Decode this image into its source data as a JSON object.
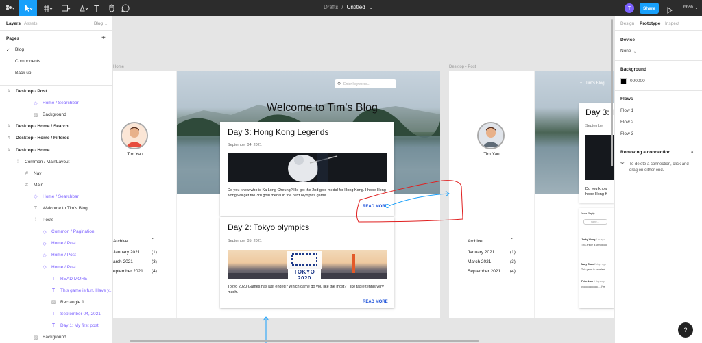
{
  "toolbar": {
    "breadcrumb_drafts": "Drafts",
    "separator": "/",
    "file_name": "Untitled",
    "avatar_letter": "T",
    "share_label": "Share",
    "zoom": "66%"
  },
  "left_panel": {
    "tab_layers": "Layers",
    "tab_assets": "Assets",
    "page_selector": "Blog",
    "pages_title": "Pages",
    "add_symbol": "+",
    "pages": [
      "Blog",
      "Components",
      "Back up"
    ],
    "layers": [
      {
        "label": "Desktop - Post",
        "kind": "frame",
        "bold": true
      },
      {
        "label": "Home / Searchbar",
        "kind": "component",
        "bold": false
      },
      {
        "label": "Background",
        "kind": "image",
        "bold": false
      },
      {
        "label": "Desktop - Home / Search",
        "kind": "frame",
        "bold": true
      },
      {
        "label": "Desktop - Home / Filtered",
        "kind": "frame",
        "bold": true
      },
      {
        "label": "Desktop - Home",
        "kind": "frame",
        "bold": true
      },
      {
        "label": "Common / MainLayout",
        "kind": "layout",
        "bold": false
      },
      {
        "label": "Nav",
        "kind": "frame",
        "bold": false
      },
      {
        "label": "Main",
        "kind": "frame",
        "bold": false
      },
      {
        "label": "Home / Searchbar",
        "kind": "component",
        "bold": false
      },
      {
        "label": "Welcome to Tim's Blog",
        "kind": "text",
        "bold": false
      },
      {
        "label": "Posts",
        "kind": "layout",
        "bold": false
      },
      {
        "label": "Common / Pagination",
        "kind": "component",
        "bold": false
      },
      {
        "label": "Home / Post",
        "kind": "component",
        "bold": false
      },
      {
        "label": "Home / Post",
        "kind": "component",
        "bold": false
      },
      {
        "label": "Home / Post",
        "kind": "component",
        "bold": false
      },
      {
        "label": "READ MORE",
        "kind": "text",
        "bold": false
      },
      {
        "label": "This game is fun. Have y...",
        "kind": "text",
        "bold": false
      },
      {
        "label": "Rectangle 1",
        "kind": "image",
        "bold": false
      },
      {
        "label": "September 04, 2021",
        "kind": "text",
        "bold": false
      },
      {
        "label": "Day 1: My first post",
        "kind": "text",
        "bold": false
      },
      {
        "label": "Background",
        "kind": "image",
        "bold": false
      }
    ]
  },
  "canvas": {
    "frame1_label": "Home",
    "frame2_label": "Desktop - Post",
    "search_placeholder": "Enter keywords...",
    "hero_title": "Welcome to Tim's Blog",
    "author": "Tim Yau",
    "post1": {
      "title": "Day 3: Hong Kong Legends",
      "date": "September 04, 2021",
      "body": "Do you know who is Ka Long Cheung? He got the 2nd gold medal for Hong Kong. I hope Hong Kong will get the 3rd gold medal in the next olympics game.",
      "read_more": "READ MORE"
    },
    "post2": {
      "title": "Day 2: Tokyo olympics",
      "date": "September 05, 2021",
      "image_text": "TOKYO 2020",
      "body": "Tokyo 2020 Games has just ended? Which game do you like the most? I like table tennis very much.",
      "read_more": "READ MORE"
    },
    "archive": {
      "title": "Archive",
      "rows": [
        {
          "month": "January 2021",
          "count": "(1)"
        },
        {
          "month": "March 2021",
          "count": "(3)"
        },
        {
          "month": "September 2021",
          "count": "(4)"
        }
      ],
      "partial_rows": [
        "January 2021",
        "arch 2021",
        "eptember 2021"
      ]
    },
    "post_page": {
      "nav_text": "Tim's Blog",
      "title": "Day 3: H",
      "date": "Septembe",
      "body_line1": "Do you know",
      "body_line2": "hope Hong K",
      "reply_title": "Your Reply",
      "reply_placeholder": "name...",
      "comments": [
        {
          "name": "Jacky Wong",
          "time": "1 hr ago",
          "text": "This article is very good."
        },
        {
          "name": "Mary Chan",
          "time": "2 days ago",
          "text": "This game is excellent."
        },
        {
          "name": "Peter Lam",
          "time": "5 days ago",
          "text": "yoooooooooooo... I've"
        }
      ]
    }
  },
  "right_panel": {
    "tabs": [
      "Design",
      "Prototype",
      "Inspect"
    ],
    "active_tab": "Prototype",
    "device_title": "Device",
    "device_value": "None",
    "background_title": "Background",
    "background_hex": "000000",
    "flows_title": "Flows",
    "flows": [
      "Flow 1",
      "Flow 2",
      "Flow 3"
    ],
    "removing_title": "Removing a connection",
    "removing_text": "To delete a connection, click and drag on either end.",
    "help": "?"
  },
  "colors": {
    "accent": "#18a0fb",
    "purple": "#7b61ff",
    "read_more": "#1a4fd8",
    "annotation": "#e02020"
  }
}
